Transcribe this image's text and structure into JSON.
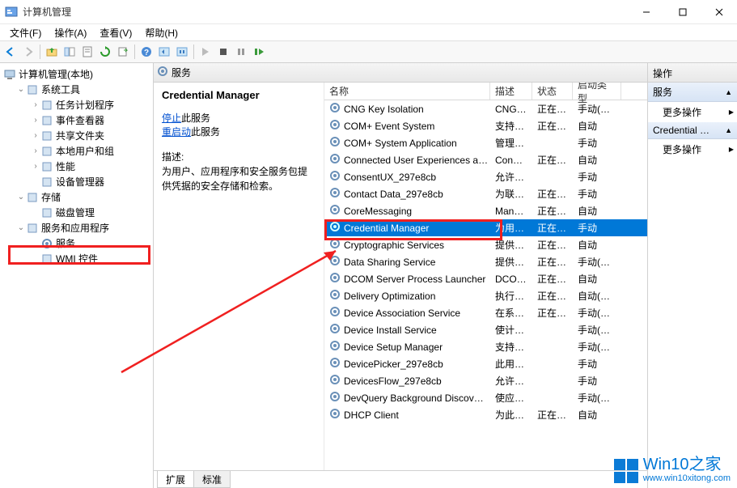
{
  "window": {
    "title": "计算机管理"
  },
  "menu": [
    "文件(F)",
    "操作(A)",
    "查看(V)",
    "帮助(H)"
  ],
  "tree": {
    "root": "计算机管理(本地)",
    "nodes": [
      {
        "label": "系统工具",
        "indent": 1,
        "exp": "∨"
      },
      {
        "label": "任务计划程序",
        "indent": 2,
        "exp": "›"
      },
      {
        "label": "事件查看器",
        "indent": 2,
        "exp": "›"
      },
      {
        "label": "共享文件夹",
        "indent": 2,
        "exp": "›"
      },
      {
        "label": "本地用户和组",
        "indent": 2,
        "exp": "›"
      },
      {
        "label": "性能",
        "indent": 2,
        "exp": "›"
      },
      {
        "label": "设备管理器",
        "indent": 2,
        "exp": ""
      },
      {
        "label": "存储",
        "indent": 1,
        "exp": "∨"
      },
      {
        "label": "磁盘管理",
        "indent": 2,
        "exp": ""
      },
      {
        "label": "服务和应用程序",
        "indent": 1,
        "exp": "∨"
      },
      {
        "label": "服务",
        "indent": 2,
        "exp": ""
      },
      {
        "label": "WMI 控件",
        "indent": 2,
        "exp": ""
      }
    ]
  },
  "center": {
    "header": "服务",
    "detail": {
      "title": "Credential Manager",
      "stop_link": "停止",
      "stop_suffix": "此服务",
      "restart_link": "重启动",
      "restart_suffix": "此服务",
      "desc_label": "描述:",
      "desc": "为用户、应用程序和安全服务包提供凭据的安全存储和检索。"
    },
    "columns": {
      "name": "名称",
      "desc": "描述",
      "status": "状态",
      "start": "启动类型"
    },
    "rows": [
      {
        "name": "CNG Key Isolation",
        "desc": "CNG…",
        "status": "正在…",
        "start": "手动(触发"
      },
      {
        "name": "COM+ Event System",
        "desc": "支持…",
        "status": "正在…",
        "start": "自动"
      },
      {
        "name": "COM+ System Application",
        "desc": "管理…",
        "status": "",
        "start": "手动"
      },
      {
        "name": "Connected User Experiences a…",
        "desc": "Con…",
        "status": "正在…",
        "start": "自动"
      },
      {
        "name": "ConsentUX_297e8cb",
        "desc": "允许…",
        "status": "",
        "start": "手动"
      },
      {
        "name": "Contact Data_297e8cb",
        "desc": "为联…",
        "status": "正在…",
        "start": "手动"
      },
      {
        "name": "CoreMessaging",
        "desc": "Man…",
        "status": "正在…",
        "start": "自动"
      },
      {
        "name": "Credential Manager",
        "desc": "为用…",
        "status": "正在…",
        "start": "手动",
        "selected": true
      },
      {
        "name": "Cryptographic Services",
        "desc": "提供…",
        "status": "正在…",
        "start": "自动"
      },
      {
        "name": "Data Sharing Service",
        "desc": "提供…",
        "status": "正在…",
        "start": "手动(触发"
      },
      {
        "name": "DCOM Server Process Launcher",
        "desc": "DCO…",
        "status": "正在…",
        "start": "自动"
      },
      {
        "name": "Delivery Optimization",
        "desc": "执行…",
        "status": "正在…",
        "start": "自动(延迟"
      },
      {
        "name": "Device Association Service",
        "desc": "在系…",
        "status": "正在…",
        "start": "手动(触发"
      },
      {
        "name": "Device Install Service",
        "desc": "使计…",
        "status": "",
        "start": "手动(触发"
      },
      {
        "name": "Device Setup Manager",
        "desc": "支持…",
        "status": "",
        "start": "手动(触发"
      },
      {
        "name": "DevicePicker_297e8cb",
        "desc": "此用…",
        "status": "",
        "start": "手动"
      },
      {
        "name": "DevicesFlow_297e8cb",
        "desc": "允许…",
        "status": "",
        "start": "手动"
      },
      {
        "name": "DevQuery Background Discov…",
        "desc": "使应…",
        "status": "",
        "start": "手动(触发"
      },
      {
        "name": "DHCP Client",
        "desc": "为此…",
        "status": "正在…",
        "start": "自动"
      }
    ],
    "tabs": [
      "扩展",
      "标准"
    ]
  },
  "actions": {
    "header": "操作",
    "sections": [
      {
        "title": "服务",
        "items": [
          "更多操作"
        ]
      },
      {
        "title": "Credential …",
        "items": [
          "更多操作"
        ]
      }
    ]
  },
  "watermark": {
    "big": "Win10之家",
    "small": "www.win10xitong.com"
  }
}
